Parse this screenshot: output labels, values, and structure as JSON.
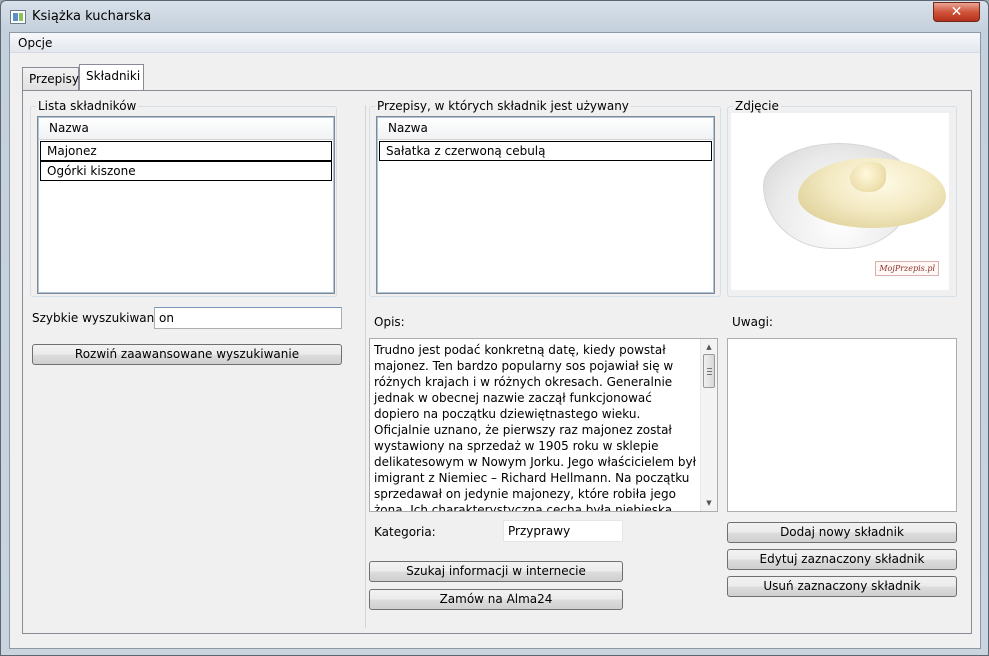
{
  "window": {
    "title": "Książka kucharska",
    "close_glyph": "✕"
  },
  "menu": {
    "options": "Opcje"
  },
  "tabs": [
    {
      "label": "Przepisy"
    },
    {
      "label": "Składniki"
    }
  ],
  "ingredients": {
    "group_title": "Lista składników",
    "column_header": "Nazwa",
    "items": [
      "Majonez",
      "Ogórki kiszone"
    ],
    "quick_search_label": "Szybkie wyszukiwanie:",
    "quick_search_value": "on",
    "advanced_search_button": "Rozwiń zaawansowane wyszukiwanie"
  },
  "recipes": {
    "group_title": "Przepisy, w których składnik jest używany",
    "column_header": "Nazwa",
    "items": [
      "Sałatka z czerwoną cebulą"
    ]
  },
  "photo": {
    "group_title": "Zdjęcie",
    "watermark": "MojPrzepis.pl"
  },
  "description": {
    "label": "Opis:",
    "text": "Trudno jest podać konkretną datę, kiedy powstał majonez. Ten bardzo popularny sos pojawiał się w różnych krajach i w różnych okresach. Generalnie jednak w obecnej nazwie zaczął funkcjonować dopiero na początku dziewiętnastego wieku. Oficjalnie uznano, że pierwszy raz majonez został wystawiony na sprzedaż w 1905 roku w sklepie delikatesowym w Nowym Jorku. Jego właścicielem był imigrant z Niemiec – Richard Hellmann. Na początku sprzedawał on jedynie majonezy, które robiła jego żona. Ich charakterystyczną cechą była niebieska wstążeczka, na opakowaniu. Popularność tych wyrobów sprawiła, że już w"
  },
  "category": {
    "label": "Kategoria:",
    "value": "Przyprawy"
  },
  "notes": {
    "label": "Uwagi:",
    "value": ""
  },
  "buttons": {
    "search_web": "Szukaj informacji w internecie",
    "order": "Zamów na Alma24",
    "add": "Dodaj nowy składnik",
    "edit": "Edytuj zaznaczony składnik",
    "delete": "Usuń zaznaczony składnik"
  },
  "scrollbar": {
    "up": "▲",
    "down": "▼"
  }
}
